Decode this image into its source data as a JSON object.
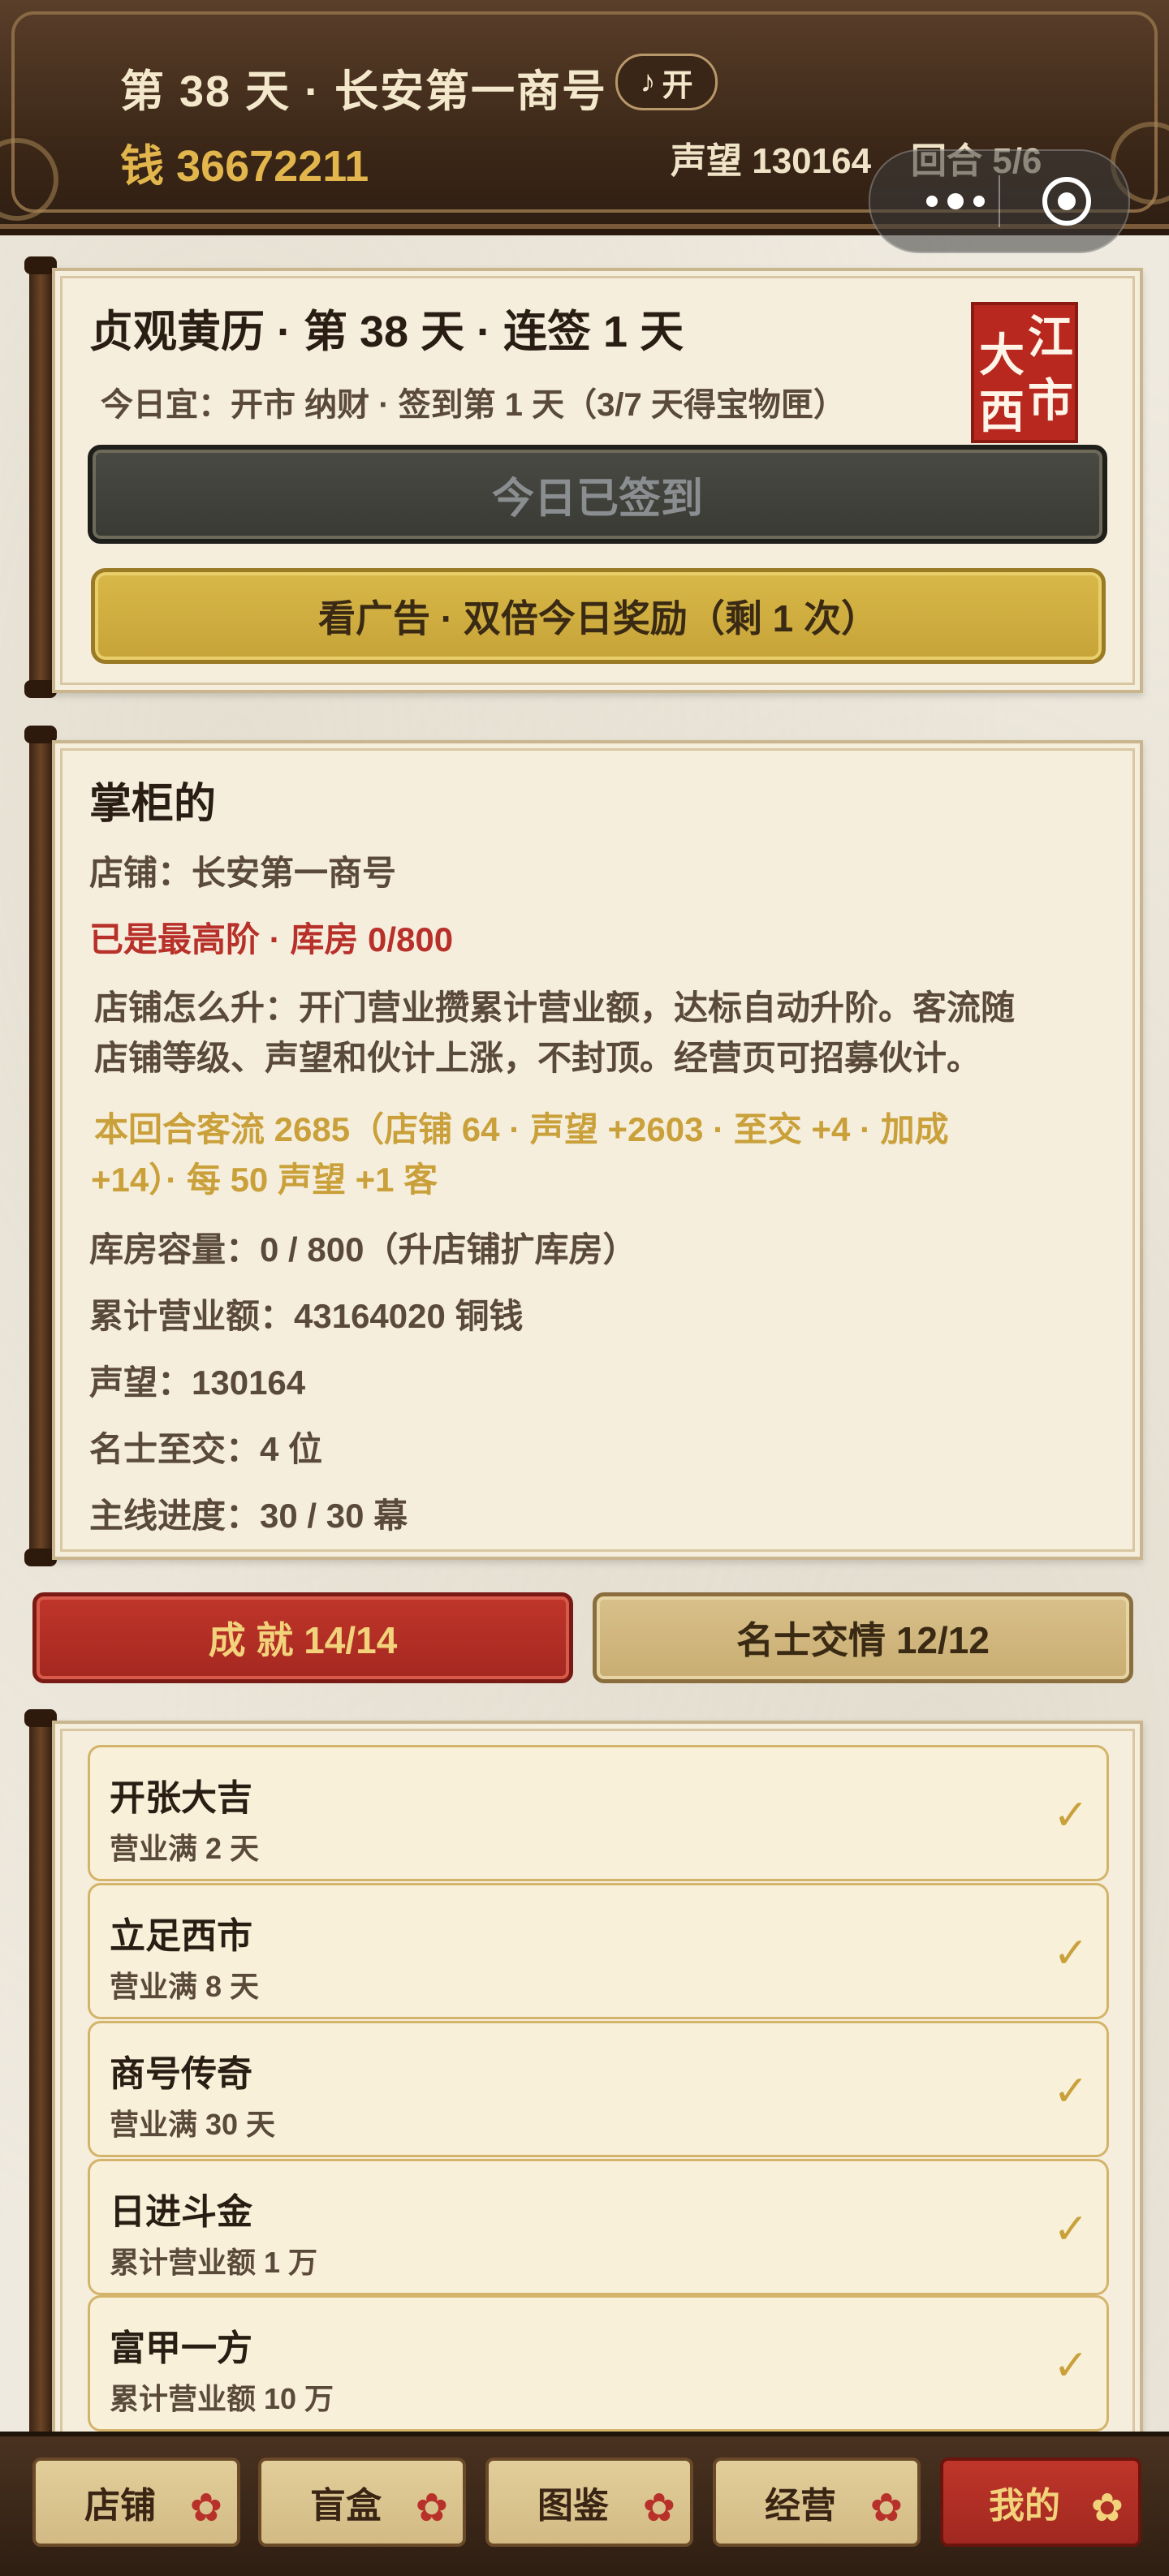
{
  "header": {
    "title": "第 38 天 · 长安第一商号",
    "music_label": "开",
    "money": "钱 36672211",
    "reputation": "声望 130164",
    "round": "回合 5/6"
  },
  "calendar": {
    "title": "贞观黄历 · 第 38 天 · 连签 1 天",
    "subtitle": "今日宜：开市 纳财 · 签到第 1 天（3/7 天得宝物匣）",
    "seal_chars": [
      "江",
      "大",
      "西",
      "市"
    ],
    "signed_button": "今日已签到",
    "ad_button": "看广告 · 双倍今日奖励（剩 1 次）"
  },
  "manager": {
    "title": "掌柜的",
    "shop": "店铺：长安第一商号",
    "tier": "已是最高阶 · 库房 0/800",
    "upgrade_line1": "店铺怎么升：开门营业攒累计营业额，达标自动升阶。客流随",
    "upgrade_line2": "店铺等级、声望和伙计上涨，不封顶。经营页可招募伙计。",
    "traffic_line1": "本回合客流 2685（店铺 64 · 声望 +2603 · 至交 +4 · 加成",
    "traffic_line2": "+14）· 每 50 声望 +1 客",
    "storage": "库房容量：0 / 800（升店铺扩库房）",
    "revenue": "累计营业额：43164020 铜钱",
    "reputation": "声望：130164",
    "friends": "名士至交：4 位",
    "progress": "主线进度：30 / 30 幕"
  },
  "tabs": {
    "achievements": "成 就 14/14",
    "friendship": "名士交情 12/12"
  },
  "achievements": [
    {
      "name": "开张大吉",
      "desc": "营业满 2 天",
      "check": "✓"
    },
    {
      "name": "立足西市",
      "desc": "营业满 8 天",
      "check": "✓"
    },
    {
      "name": "商号传奇",
      "desc": "营业满 30 天",
      "check": "✓"
    },
    {
      "name": "日进斗金",
      "desc": "累计营业额 1 万",
      "check": "✓"
    },
    {
      "name": "富甲一方",
      "desc": "累计营业额 10 万",
      "check": "✓"
    }
  ],
  "nav": {
    "shop": "店铺",
    "blindbox": "盲盒",
    "catalog": "图鉴",
    "business": "经营",
    "mine": "我的"
  },
  "colors": {
    "accent_gold": "#c9a03a",
    "accent_red": "#b8302a",
    "paper": "#f6eedd"
  }
}
